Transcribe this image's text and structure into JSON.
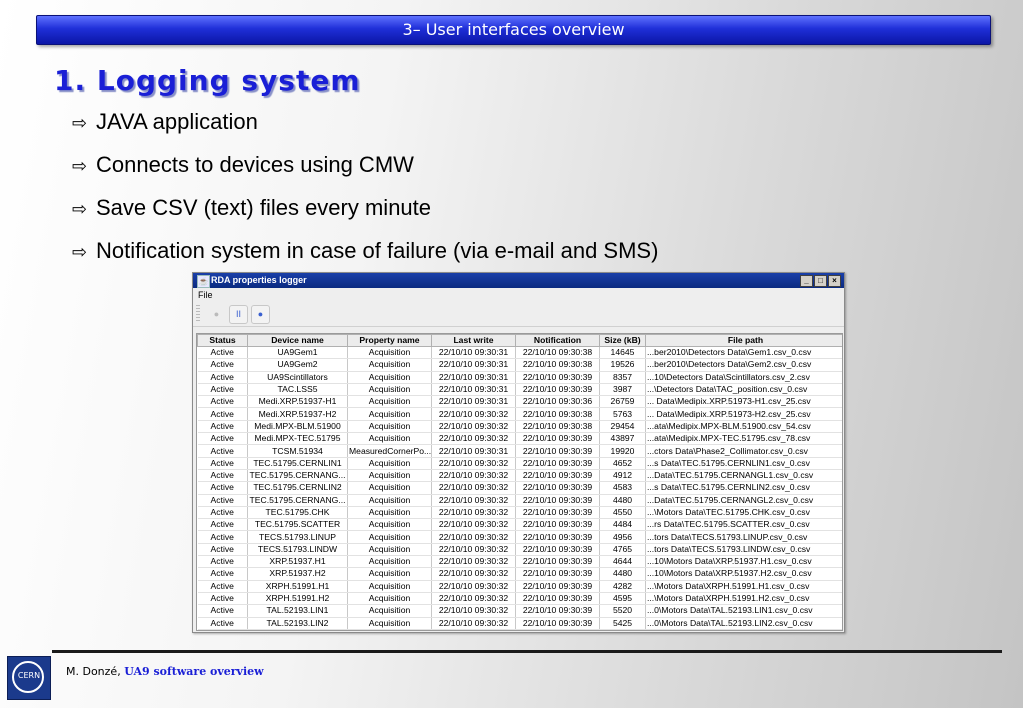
{
  "slide": {
    "banner": "3– User interfaces overview",
    "heading": "1. Logging system",
    "bullets": [
      "JAVA application",
      "Connects to devices using CMW",
      "Save CSV (text) files every minute",
      "Notification system in case of failure (via e-mail and SMS)"
    ],
    "bullet_icon": "right-arrow-icon",
    "footer_author": "M. Donzé, ",
    "footer_title": "UA9 software overview"
  },
  "window": {
    "title": "RDA properties logger",
    "menu_file": "File",
    "controls": [
      "_",
      "□",
      "×"
    ],
    "toolbar": {
      "stop": "●",
      "pause": "II",
      "record": "●"
    },
    "columns": [
      "Status",
      "Device name",
      "Property name",
      "Last write",
      "Notification",
      "Size (kB)",
      "File path"
    ],
    "rows": [
      [
        "Active",
        "UA9Gem1",
        "Acquisition",
        "22/10/10 09:30:31",
        "22/10/10 09:30:38",
        "14645",
        "...ber2010\\Detectors Data\\Gem1.csv_0.csv"
      ],
      [
        "Active",
        "UA9Gem2",
        "Acquisition",
        "22/10/10 09:30:31",
        "22/10/10 09:30:38",
        "19526",
        "...ber2010\\Detectors Data\\Gem2.csv_0.csv"
      ],
      [
        "Active",
        "UA9Scintillators",
        "Acquisition",
        "22/10/10 09:30:31",
        "22/10/10 09:30:39",
        "8357",
        "...10\\Detectors Data\\Scintillators.csv_2.csv"
      ],
      [
        "Active",
        "TAC.LSS5",
        "Acquisition",
        "22/10/10 09:30:31",
        "22/10/10 09:30:39",
        "3987",
        "...\\Detectors Data\\TAC_position.csv_0.csv"
      ],
      [
        "Active",
        "Medi.XRP.51937-H1",
        "Acquisition",
        "22/10/10 09:30:31",
        "22/10/10 09:30:36",
        "26759",
        "... Data\\Medipix.XRP.51973-H1.csv_25.csv"
      ],
      [
        "Active",
        "Medi.XRP.51937-H2",
        "Acquisition",
        "22/10/10 09:30:32",
        "22/10/10 09:30:38",
        "5763",
        "... Data\\Medipix.XRP.51973-H2.csv_25.csv"
      ],
      [
        "Active",
        "Medi.MPX-BLM.51900",
        "Acquisition",
        "22/10/10 09:30:32",
        "22/10/10 09:30:38",
        "29454",
        "...ata\\Medipix.MPX-BLM.51900.csv_54.csv"
      ],
      [
        "Active",
        "Medi.MPX-TEC.51795",
        "Acquisition",
        "22/10/10 09:30:32",
        "22/10/10 09:30:39",
        "43897",
        "...ata\\Medipix.MPX-TEC.51795.csv_78.csv"
      ],
      [
        "Active",
        "TCSM.51934",
        "MeasuredCornerPo...",
        "22/10/10 09:30:31",
        "22/10/10 09:30:39",
        "19920",
        "...ctors Data\\Phase2_Collimator.csv_0.csv"
      ],
      [
        "Active",
        "TEC.51795.CERNLIN1",
        "Acquisition",
        "22/10/10 09:30:32",
        "22/10/10 09:30:39",
        "4652",
        "...s Data\\TEC.51795.CERNLIN1.csv_0.csv"
      ],
      [
        "Active",
        "TEC.51795.CERNANG...",
        "Acquisition",
        "22/10/10 09:30:32",
        "22/10/10 09:30:39",
        "4912",
        "...Data\\TEC.51795.CERNANGL1.csv_0.csv"
      ],
      [
        "Active",
        "TEC.51795.CERNLIN2",
        "Acquisition",
        "22/10/10 09:30:32",
        "22/10/10 09:30:39",
        "4583",
        "...s Data\\TEC.51795.CERNLIN2.csv_0.csv"
      ],
      [
        "Active",
        "TEC.51795.CERNANG...",
        "Acquisition",
        "22/10/10 09:30:32",
        "22/10/10 09:30:39",
        "4480",
        "...Data\\TEC.51795.CERNANGL2.csv_0.csv"
      ],
      [
        "Active",
        "TEC.51795.CHK",
        "Acquisition",
        "22/10/10 09:30:32",
        "22/10/10 09:30:39",
        "4550",
        "...\\Motors Data\\TEC.51795.CHK.csv_0.csv"
      ],
      [
        "Active",
        "TEC.51795.SCATTER",
        "Acquisition",
        "22/10/10 09:30:32",
        "22/10/10 09:30:39",
        "4484",
        "...rs Data\\TEC.51795.SCATTER.csv_0.csv"
      ],
      [
        "Active",
        "TECS.51793.LINUP",
        "Acquisition",
        "22/10/10 09:30:32",
        "22/10/10 09:30:39",
        "4956",
        "...tors Data\\TECS.51793.LINUP.csv_0.csv"
      ],
      [
        "Active",
        "TECS.51793.LINDW",
        "Acquisition",
        "22/10/10 09:30:32",
        "22/10/10 09:30:39",
        "4765",
        "...tors Data\\TECS.51793.LINDW.csv_0.csv"
      ],
      [
        "Active",
        "XRP.51937.H1",
        "Acquisition",
        "22/10/10 09:30:32",
        "22/10/10 09:30:39",
        "4644",
        "...10\\Motors Data\\XRP.51937.H1.csv_0.csv"
      ],
      [
        "Active",
        "XRP.51937.H2",
        "Acquisition",
        "22/10/10 09:30:32",
        "22/10/10 09:30:39",
        "4480",
        "...10\\Motors Data\\XRP.51937.H2.csv_0.csv"
      ],
      [
        "Active",
        "XRPH.51991.H1",
        "Acquisition",
        "22/10/10 09:30:32",
        "22/10/10 09:30:39",
        "4282",
        "...\\Motors Data\\XRPH.51991.H1.csv_0.csv"
      ],
      [
        "Active",
        "XRPH.51991.H2",
        "Acquisition",
        "22/10/10 09:30:32",
        "22/10/10 09:30:39",
        "4595",
        "...\\Motors Data\\XRPH.51991.H2.csv_0.csv"
      ],
      [
        "Active",
        "TAL.52193.LIN1",
        "Acquisition",
        "22/10/10 09:30:32",
        "22/10/10 09:30:39",
        "5520",
        "...0\\Motors Data\\TAL.52193.LIN1.csv_0.csv"
      ],
      [
        "Active",
        "TAL.52193.LIN2",
        "Acquisition",
        "22/10/10 09:30:32",
        "22/10/10 09:30:39",
        "5425",
        "...0\\Motors Data\\TAL.52193.LIN2.csv_0.csv"
      ]
    ]
  },
  "logo": {
    "text": "CERN"
  },
  "colors": {
    "banner": "#1f2fd8",
    "heading": "#1a1fd6",
    "link": "#1a1fd6"
  }
}
